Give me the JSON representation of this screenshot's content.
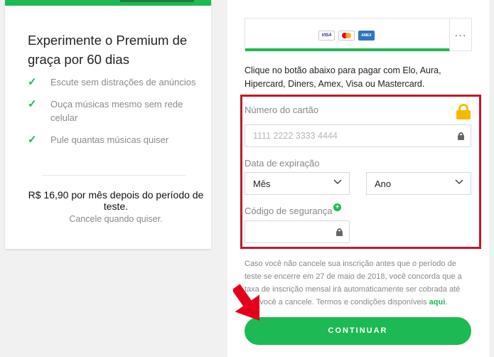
{
  "promo": {
    "title": "Experimente o Premium de graça por 60 dias",
    "features": [
      "Escute sem distrações de anúncios",
      "Ouça músicas mesmo sem rede celular",
      "Pule quantas músicas quiser"
    ],
    "price": "R$ 16,90 por mês depois do período de teste.",
    "cancel_note": "Cancele quando quiser."
  },
  "payment": {
    "card_brands": [
      "VISA",
      "",
      "AMEX"
    ],
    "more_label": "···",
    "instructions": "Clique no botão abaixo para pagar com Elo, Aura, Hipercard, Diners, Amex, Visa ou Mastercard.",
    "card_number_label": "Número do cartão",
    "card_number_placeholder": "1111 2222 3333 4444",
    "expiry_label": "Data de expiração",
    "month_value": "Mês",
    "year_value": "Ano",
    "security_code_label": "Código de segurança",
    "legal_text": "Caso você não cancele sua inscrição antes que o período de teste se encerre em 27 de maio de 2018, você concorda que a taxa de inscrição mensal irá automaticamente ser cobrada até que você a cancele. Termos e condições disponíveis ",
    "legal_link": "aqui",
    "legal_end": ".",
    "continue_label": "CONTINUAR"
  },
  "colors": {
    "accent": "#1db954",
    "highlight": "#c3182c",
    "lock": "#f5b800",
    "arrow": "#e4001b"
  }
}
